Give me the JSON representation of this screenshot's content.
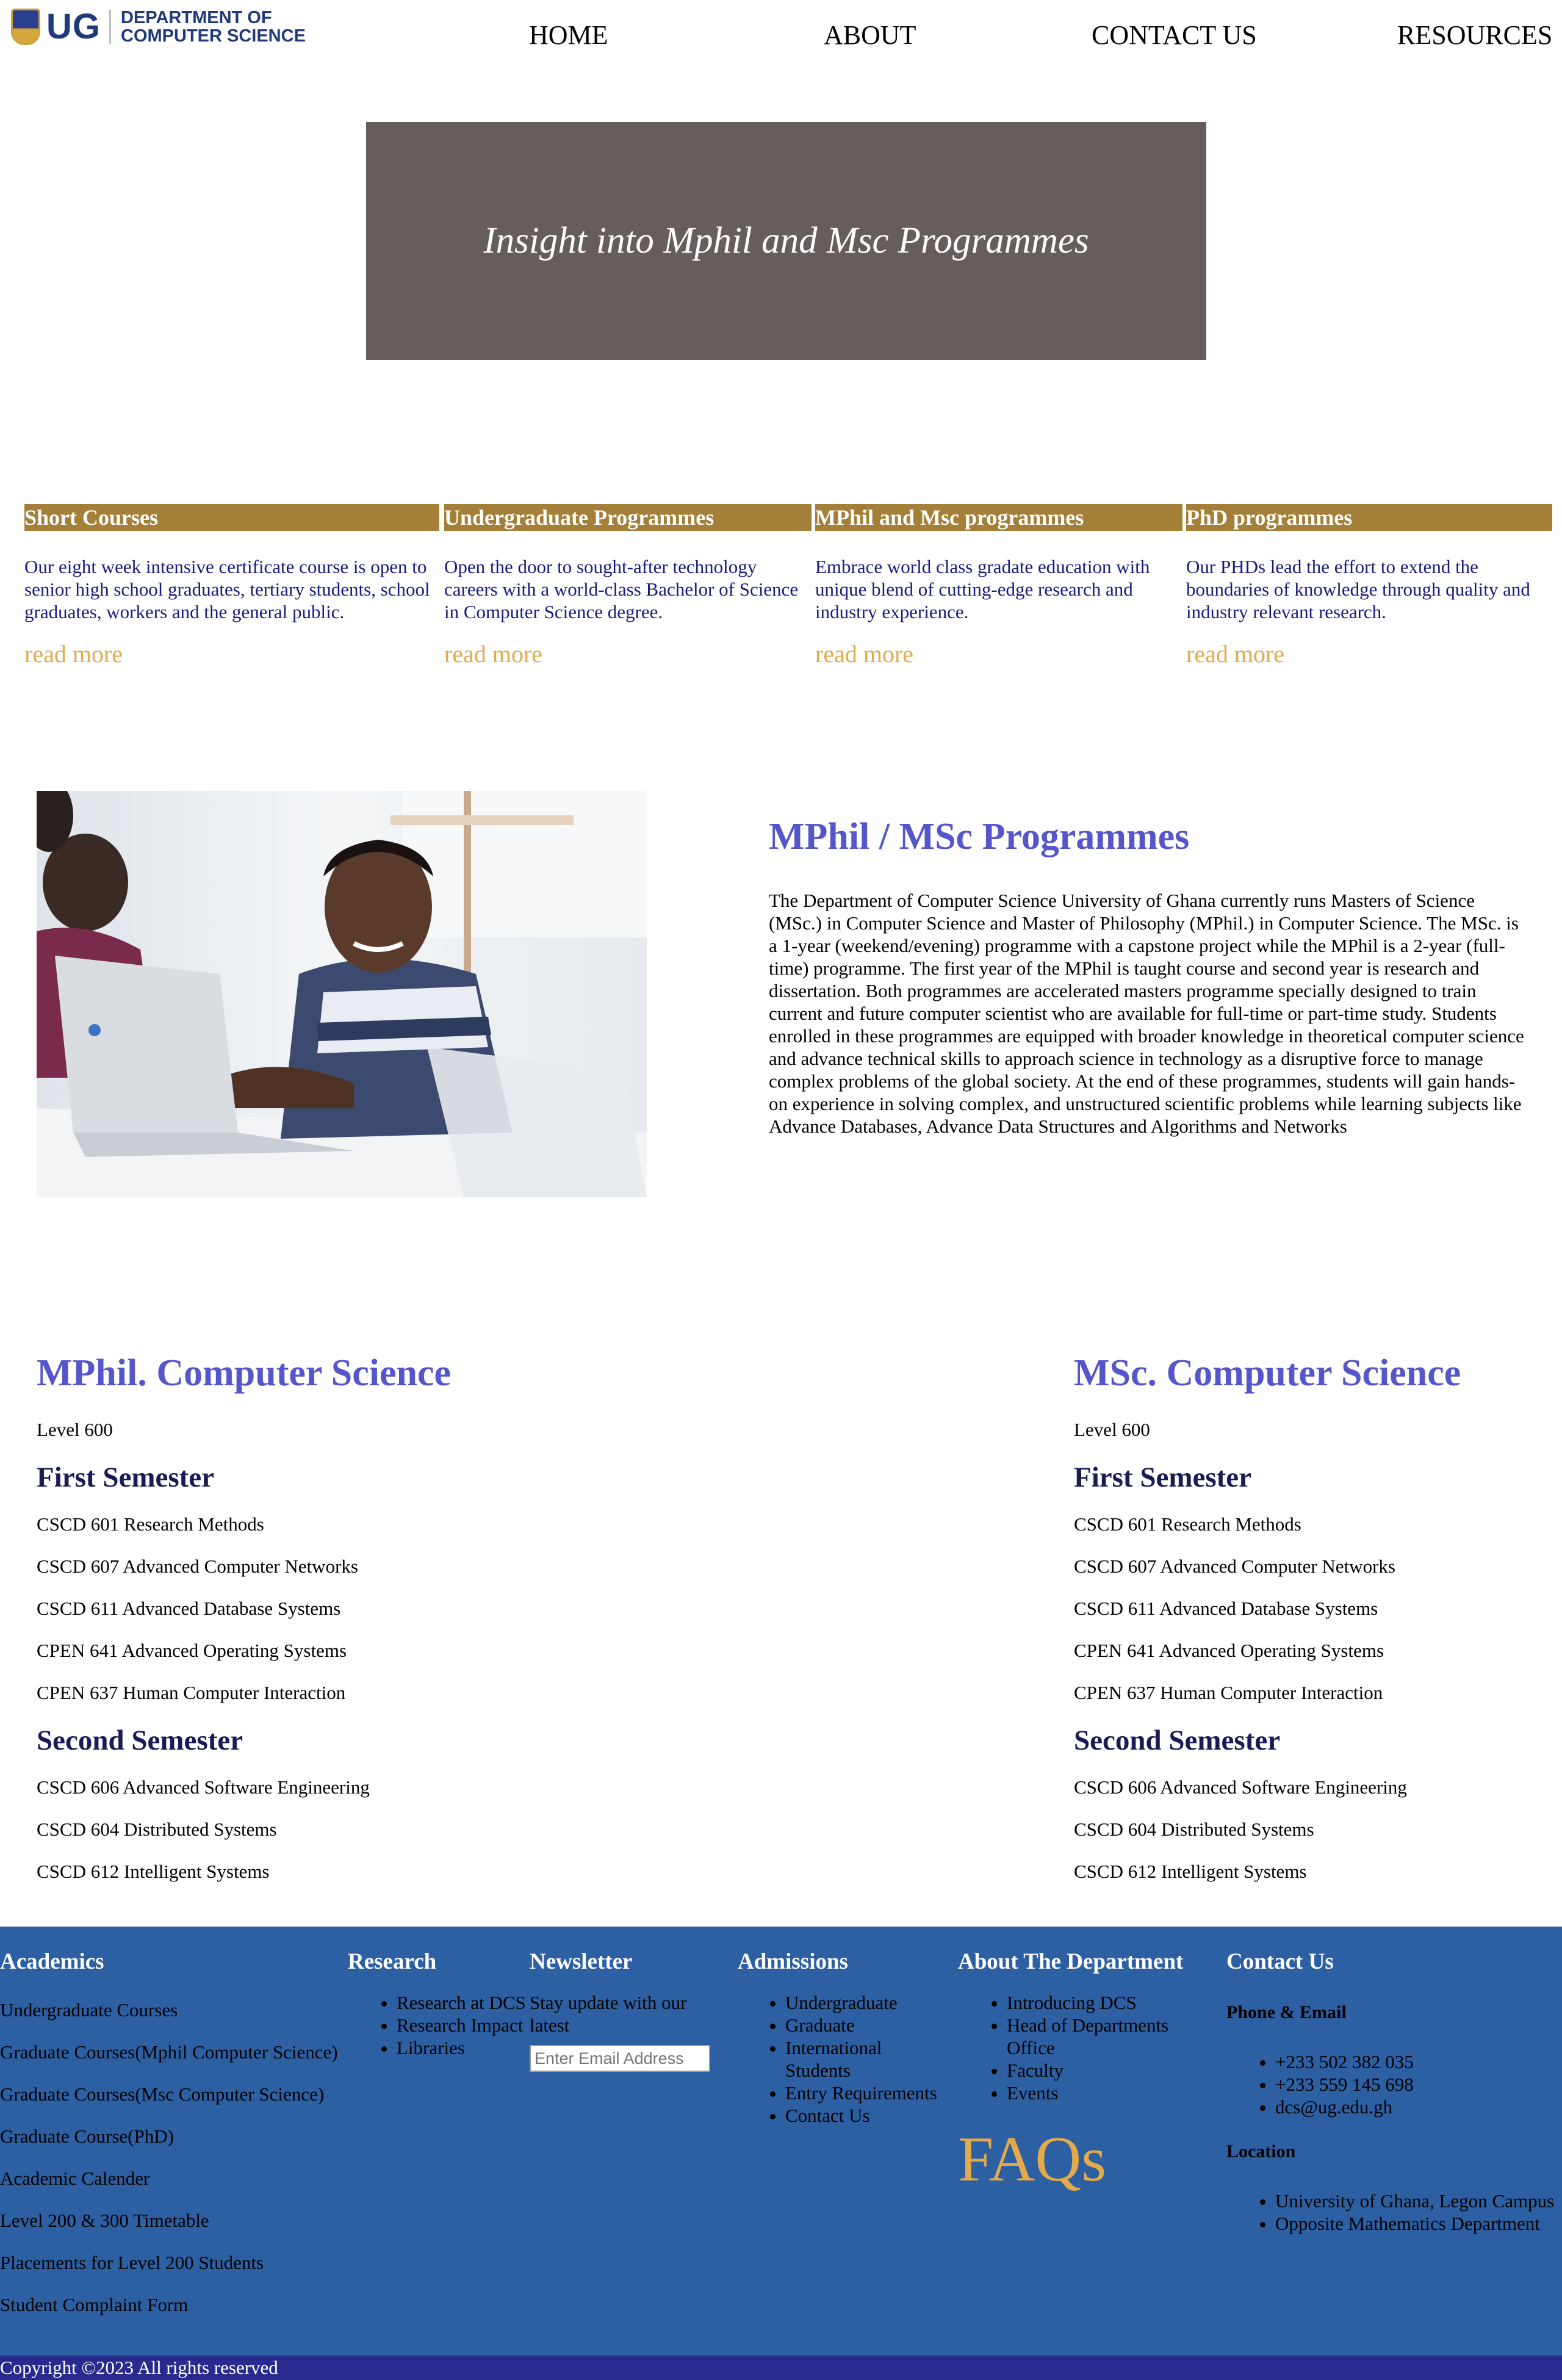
{
  "header": {
    "logo_text": "UG",
    "dept_line1": "DEPARTMENT OF",
    "dept_line2": "COMPUTER SCIENCE",
    "nav": [
      "HOME",
      "ABOUT",
      "CONTACT US",
      "RESOURCES"
    ]
  },
  "hero": {
    "title": "Insight into Mphil and Msc Programmes"
  },
  "programmes": [
    {
      "title": "Short Courses",
      "text": "Our eight week intensive certificate course is open to senior high school graduates, tertiary students, school graduates, workers and the general public.",
      "link": "read more"
    },
    {
      "title": "Undergraduate Programmes",
      "text": "Open the door to sought-after technology careers with a world-class Bachelor of Science in Computer Science degree.",
      "link": "read more"
    },
    {
      "title": "MPhil and Msc programmes",
      "text": "Embrace world class gradate education with unique blend of cutting-edge research and industry experience.",
      "link": "read more"
    },
    {
      "title": "PhD programmes",
      "text": "Our PHDs lead the effort to extend the boundaries of knowledge through quality and industry relevant research.",
      "link": "read more"
    }
  ],
  "intro": {
    "title": "MPhil / MSc Programmes",
    "text": "The Department of Computer Science University of Ghana currently runs Masters of Science (MSc.) in Computer Science and Master of Philosophy (MPhil.) in Computer Science. The MSc. is a 1-year (weekend/evening) programme with a capstone project while the MPhil is a 2-year (full-time) programme. The first year of the MPhil is taught course and second year is research and dissertation. Both programmes are accelerated masters programme specially designed to train current and future computer scientist who are available for full-time or part-time study. Students enrolled in these programmes are equipped with broader knowledge in theoretical computer science and advance technical skills to approach science in technology as a disruptive force to manage complex problems of the global society. At the end of these programmes, students will gain hands-on experience in solving complex, and unstructured scientific problems while learning subjects like Advance Databases, Advance Data Structures and Algorithms and Networks"
  },
  "mphil": {
    "title": "MPhil. Computer Science",
    "level": "Level 600",
    "first_sem_title": "First Semester",
    "first_sem": [
      "CSCD 601 Research Methods",
      "CSCD 607 Advanced Computer Networks",
      "CSCD 611 Advanced Database Systems",
      "CPEN 641 Advanced Operating Systems",
      "CPEN 637 Human Computer Interaction"
    ],
    "second_sem_title": "Second Semester",
    "second_sem": [
      "CSCD 606 Advanced Software Engineering",
      "CSCD 604 Distributed Systems",
      "CSCD 612 Intelligent Systems"
    ]
  },
  "msc": {
    "title": "MSc. Computer Science",
    "level": "Level 600",
    "first_sem_title": "First Semester",
    "first_sem": [
      "CSCD 601 Research Methods",
      "CSCD 607 Advanced Computer Networks",
      "CSCD 611 Advanced Database Systems",
      "CPEN 641 Advanced Operating Systems",
      "CPEN 637 Human Computer Interaction"
    ],
    "second_sem_title": "Second Semester",
    "second_sem": [
      "CSCD 606 Advanced Software Engineering",
      "CSCD 604 Distributed Systems",
      "CSCD 612 Intelligent Systems"
    ]
  },
  "footer": {
    "academics": {
      "title": "Academics",
      "links": [
        "Undergraduate Courses",
        "Graduate Courses(Mphil Computer Science)",
        "Graduate Courses(Msc Computer Science)",
        "Graduate Course(PhD)",
        "Academic Calender",
        "Level 200 & 300 Timetable",
        "Placements for Level 200 Students",
        "Student Complaint Form"
      ]
    },
    "research": {
      "title": "Research",
      "links": [
        "Research at DCS",
        "Research Impact",
        "Libraries"
      ]
    },
    "newsletter": {
      "title": "Newsletter",
      "text": "Stay update with our latest",
      "placeholder": "Enter Email Address"
    },
    "admissions": {
      "title": "Admissions",
      "links": [
        "Undergraduate",
        "Graduate",
        "International Students",
        "Entry Requirements",
        "Contact Us"
      ]
    },
    "about": {
      "title": "About The Department",
      "links": [
        "Introducing DCS",
        "Head of Departments Office",
        "Faculty",
        "Events"
      ],
      "faqs": "FAQs"
    },
    "contact": {
      "title": "Contact Us",
      "phone_title": "Phone & Email",
      "phone_items": [
        "+233 502 382 035",
        "+233 559 145 698",
        "dcs@ug.edu.gh"
      ],
      "location_title": "Location",
      "location_items": [
        "University of Ghana, Legon Campus",
        "Opposite Mathematics Department"
      ]
    },
    "copyright": "Copyright ©2023 All rights reserved"
  },
  "colors": {
    "hero_bg": "#665e5c",
    "card_title_bg": "#a47f37",
    "read_more": "#e2aa4b",
    "heading_purple": "#5555cc",
    "footer_bg": "#2d5fa3",
    "copyright_bg": "#2a2a8e"
  }
}
